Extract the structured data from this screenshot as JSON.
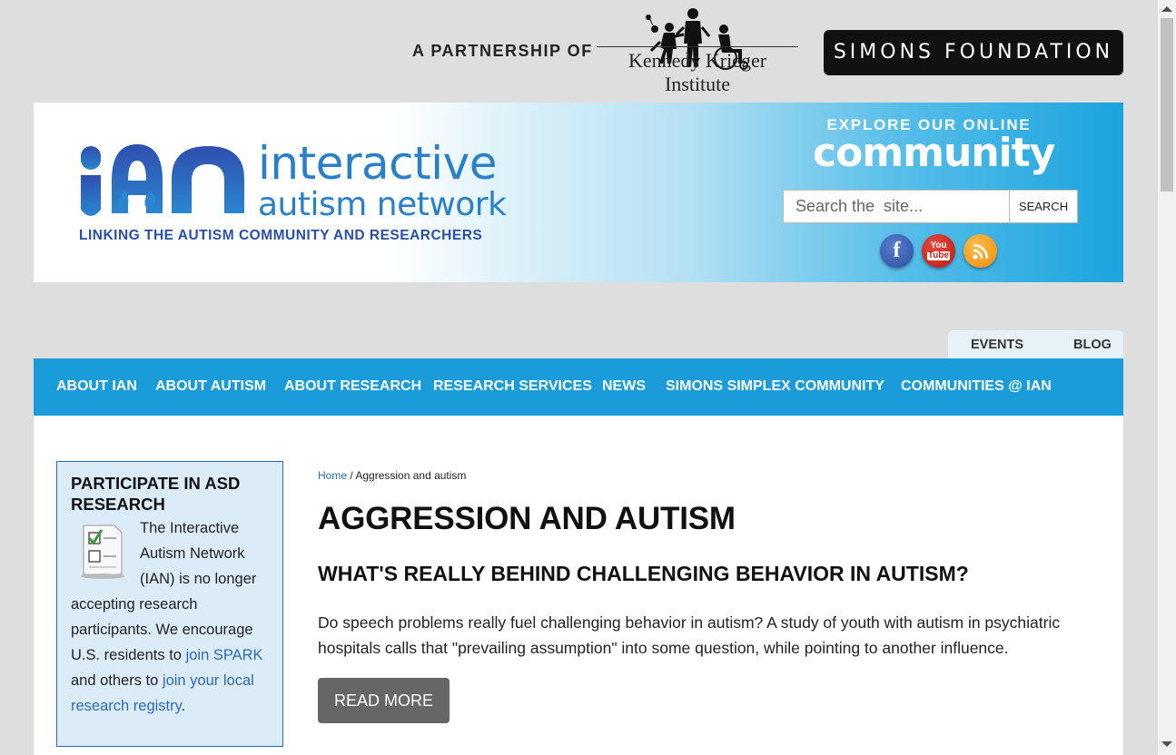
{
  "partnership": {
    "label": "A PARTNERSHIP OF",
    "kki_name": "Kennedy Krieger Institute",
    "simons_name": "SIMONS FOUNDATION"
  },
  "header": {
    "logo_word1": "interactive",
    "logo_word2": "autism network",
    "tagline": "LINKING THE AUTISM COMMUNITY AND RESEARCHERS",
    "explore_label": "EXPLORE OUR ONLINE",
    "community_label": "community",
    "search": {
      "placeholder": "Search the  site...",
      "button": "SEARCH"
    },
    "social": {
      "facebook": "f",
      "youtube_top": "You",
      "youtube_bottom": "Tube"
    }
  },
  "secondary_nav": {
    "events": "EVENTS",
    "blog": "BLOG"
  },
  "main_nav": [
    "ABOUT IAN",
    "ABOUT AUTISM",
    "ABOUT RESEARCH",
    "RESEARCH SERVICES",
    "NEWS",
    "SIMONS SIMPLEX COMMUNITY",
    "COMMUNITIES @ IAN"
  ],
  "sidebar": {
    "title": "PARTICIPATE IN ASD RESEARCH",
    "text_part1": "The Interactive Autism Network (IAN) is no longer accepting research participants. We encourage U.S. residents to ",
    "link1": "join SPARK",
    "text_part2": " and others to ",
    "link2": "join your local research registry",
    "text_part3": "."
  },
  "breadcrumb": {
    "home": "Home",
    "separator": " / ",
    "current": "Aggression and autism"
  },
  "page_title": "AGGRESSION AND AUTISM",
  "article": {
    "title": "WHAT'S REALLY BEHIND CHALLENGING BEHAVIOR IN AUTISM?",
    "text": "Do speech problems really fuel challenging behavior in autism? A study of youth with autism in psychiatric hospitals calls that \"prevailing assumption\" into some question, while pointing to another influence.",
    "read_more": "READ MORE"
  },
  "colors": {
    "nav_blue": "#1a9cdb",
    "logo_blue": "#2a7fc9",
    "link_blue": "#2a6cb5",
    "sidebar_bg": "#dcebf8"
  }
}
